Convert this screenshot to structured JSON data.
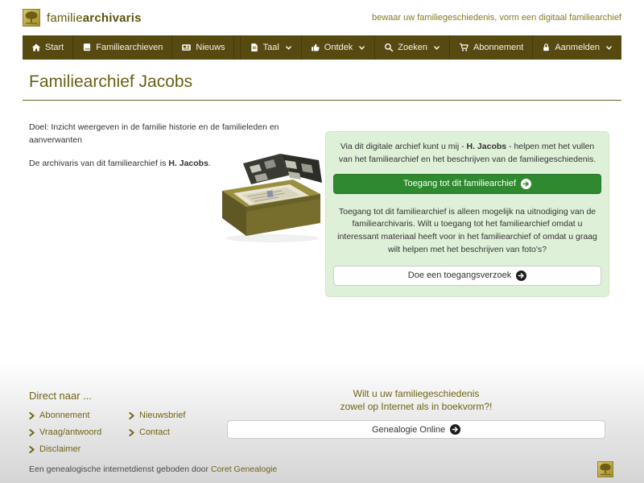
{
  "brand": {
    "name_regular": "familie",
    "name_bold": "archivaris",
    "tagline": "bewaar uw familiegeschiedenis, vorm een digitaal familiearchief"
  },
  "nav": {
    "left": [
      {
        "label": "Start",
        "icon": "home-icon"
      },
      {
        "label": "Familiearchieven",
        "icon": "book-icon"
      },
      {
        "label": "Nieuws",
        "icon": "newspaper-icon"
      }
    ],
    "right": [
      {
        "label": "Taal",
        "icon": "language-icon",
        "dropdown": true
      },
      {
        "label": "Ontdek",
        "icon": "thumbs-up-icon",
        "dropdown": true
      },
      {
        "label": "Zoeken",
        "icon": "search-icon",
        "dropdown": true
      },
      {
        "label": "Abonnement",
        "icon": "cart-icon",
        "dropdown": false
      },
      {
        "label": "Aanmelden",
        "icon": "lock-icon",
        "dropdown": true
      }
    ]
  },
  "page": {
    "title": "Familiearchief Jacobs"
  },
  "intro": {
    "doel": "Doel: Inzicht weergeven in de familie historie en de familieleden en aanverwanten",
    "archivaris_prefix": "De archivaris van dit familiearchief is ",
    "archivaris_name": "H. Jacobs",
    "archivaris_suffix": "."
  },
  "panel": {
    "p1_before": "Via dit digitale archief kunt u mij - ",
    "p1_name": "H. Jacobs",
    "p1_after": " - helpen met het vullen van het familiearchief en het beschrijven van de familiegeschiedenis.",
    "primary_button": "Toegang tot dit familiearchief",
    "p2": "Toegang tot dit familiearchief is alleen mogelijk na uitnodiging van de familiearchivaris. Wilt u toegang tot het familiearchief omdat u interessant materiaal heeft voor in het familiearchief of omdat u graag wilt helpen met het beschrijven van foto's?",
    "secondary_button": "Doe een toegangsverzoek"
  },
  "footer": {
    "direct_heading": "Direct naar ...",
    "links_col1": [
      "Abonnement",
      "Vraag/antwoord",
      "Disclaimer"
    ],
    "links_col2": [
      "Nieuwsbrief",
      "Contact"
    ],
    "promo_line1": "Wilt u uw familiegeschiedenis",
    "promo_line2": "zowel op Internet als in boekvorm?!",
    "promo_button": "Genealogie Online",
    "credit_prefix": "Een genealogische internetdienst geboden door ",
    "credit_link": "Coret Genealogie"
  },
  "colors": {
    "nav_bg": "#574a11",
    "brand_olive": "#635909",
    "title_olive": "#6a6014",
    "footer_link_olive": "#6f6415",
    "accent_green": "#2f8a2f",
    "panel_bg": "#dff0d8"
  }
}
